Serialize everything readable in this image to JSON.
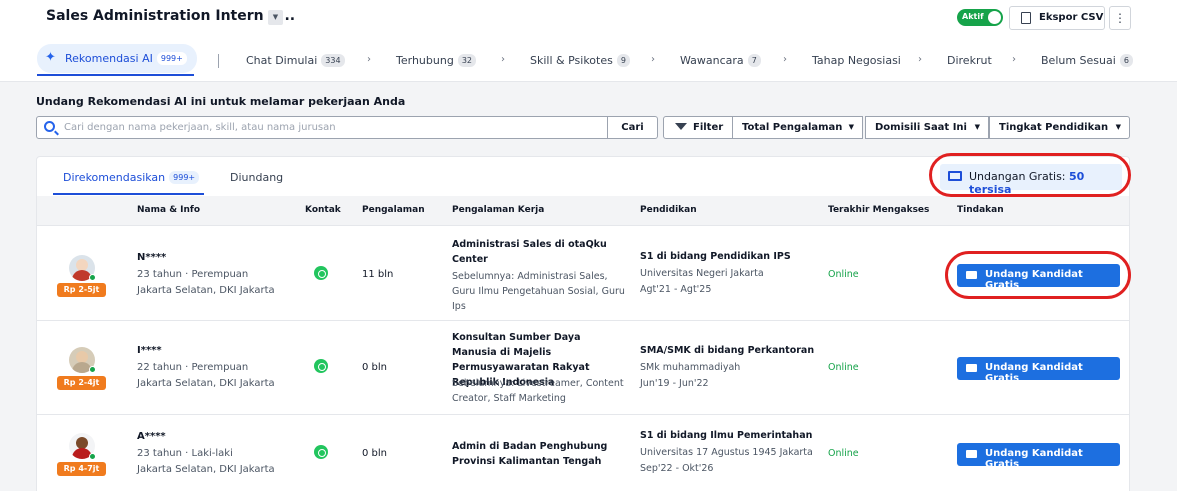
{
  "header": {
    "title": "Sales Administration Intern - ...",
    "status_toggle": "Aktif",
    "export_label": "Ekspor CSV"
  },
  "tabs": [
    {
      "label": "Rekomendasi AI",
      "count": "999+"
    },
    {
      "label": "Chat Dimulai",
      "count": "334"
    },
    {
      "label": "Terhubung",
      "count": "32"
    },
    {
      "label": "Skill & Psikotes",
      "count": "9"
    },
    {
      "label": "Wawancara",
      "count": "7"
    },
    {
      "label": "Tahap Negosiasi",
      "count": ""
    },
    {
      "label": "Direkrut",
      "count": ""
    },
    {
      "label": "Belum Sesuai",
      "count": "6"
    }
  ],
  "search": {
    "headline": "Undang Rekomendasi AI ini untuk melamar pekerjaan Anda",
    "placeholder": "Cari dengan nama pekerjaan, skill, atau nama jurusan",
    "button": "Cari",
    "filters": [
      "Filter",
      "Total Pengalaman",
      "Domisili Saat Ini",
      "Tingkat Pendidikan"
    ]
  },
  "subtabs": [
    {
      "label": "Direkomendasikan",
      "count": "999+"
    },
    {
      "label": "Diundang"
    }
  ],
  "quota": {
    "label": "Undangan Gratis:",
    "value": "50 tersisa"
  },
  "columns": [
    "Nama & Info",
    "Kontak",
    "Pengalaman",
    "Pengalaman Kerja",
    "Pendidikan",
    "Terakhir Mengakses",
    "Tindakan"
  ],
  "candidates": [
    {
      "name": "N****",
      "info1": "23 tahun · Perempuan",
      "info2": "Jakarta Selatan, DKI Jakarta",
      "salary": "Rp 2-5jt",
      "experience": "11 bln",
      "job_title": "Administrasi Sales di otaQku Center",
      "job_prev": "Sebelumnya: Administrasi Sales, Guru Ilmu Pengetahuan Sosial, Guru Ips",
      "edu_title": "S1 di bidang Pendidikan IPS",
      "edu_school": "Universitas Negeri Jakarta",
      "edu_period": "Agt'21 - Agt'25",
      "last_access": "Online",
      "action": "Undang Kandidat Gratis",
      "avatar_color": "#c0392b"
    },
    {
      "name": "I****",
      "info1": "22 tahun · Perempuan",
      "info2": "Jakarta Selatan, DKI Jakarta",
      "salary": "Rp 2-4jt",
      "experience": "0 bln",
      "job_title": "Konsultan Sumber Daya Manusia di Majelis Permusyawaratan Rakyat Republik Indonesia",
      "job_prev": "Sebelumnya: Livestreamer, Content Creator, Staff Marketing",
      "edu_title": "SMA/SMK di bidang Perkantoran",
      "edu_school": "SMk muhammadiyah",
      "edu_period": "Jun'19 - Jun'22",
      "last_access": "Online",
      "action": "Undang Kandidat Gratis",
      "avatar_color": "#c8b9a0"
    },
    {
      "name": "A****",
      "info1": "23 tahun · Laki-laki",
      "info2": "Jakarta Selatan, DKI Jakarta",
      "salary": "Rp 4-7jt",
      "experience": "0 bln",
      "job_title": "Admin di Badan Penghubung Provinsi Kalimantan Tengah",
      "job_prev": "",
      "edu_title": "S1 di bidang Ilmu Pemerintahan",
      "edu_school": "Universitas 17 Agustus 1945 Jakarta",
      "edu_period": "Sep'22 - Okt'26",
      "last_access": "Online",
      "action": "Undang Kandidat Gratis",
      "avatar_color": "#b91c1c"
    }
  ]
}
